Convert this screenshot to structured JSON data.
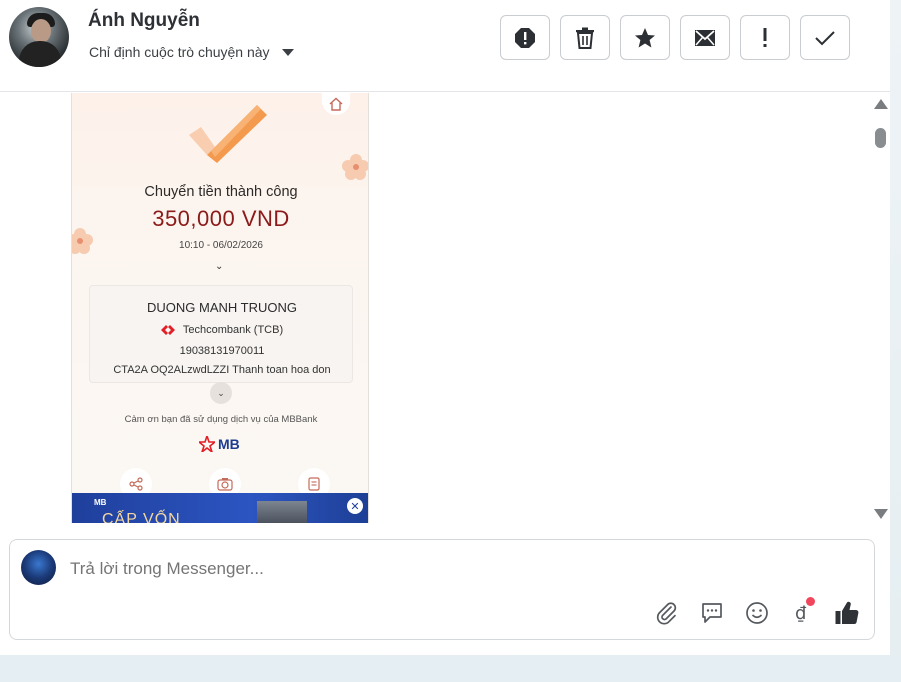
{
  "header": {
    "name": "Ánh Nguyễn",
    "assign_label": "Chỉ định cuộc trò chuyện này",
    "action_icons": [
      "spam-icon",
      "trash-icon",
      "star-icon",
      "mail-icon",
      "priority-icon",
      "check-icon"
    ]
  },
  "receipt": {
    "title": "Chuyển tiền thành công",
    "amount": "350,000 VND",
    "time": "10:10 - 06/02/2026",
    "recipient": "DUONG MANH TRUONG",
    "bank": "Techcombank (TCB)",
    "account": "19038131970011",
    "memo": "CTA2A OQ2ALzwdLZZI Thanh toan hoa don",
    "thanks": "Cảm ơn bạn đã sử dụng dịch vụ của MBBank",
    "logo_text": "MB",
    "banner_brand": "MB",
    "banner_text": "CẤP VỐN"
  },
  "composer": {
    "placeholder": "Trả lời trong Messenger..."
  },
  "colors": {
    "amount": "#8b1a1a",
    "logo": "#1d3c8f",
    "badge": "#f0475d"
  }
}
